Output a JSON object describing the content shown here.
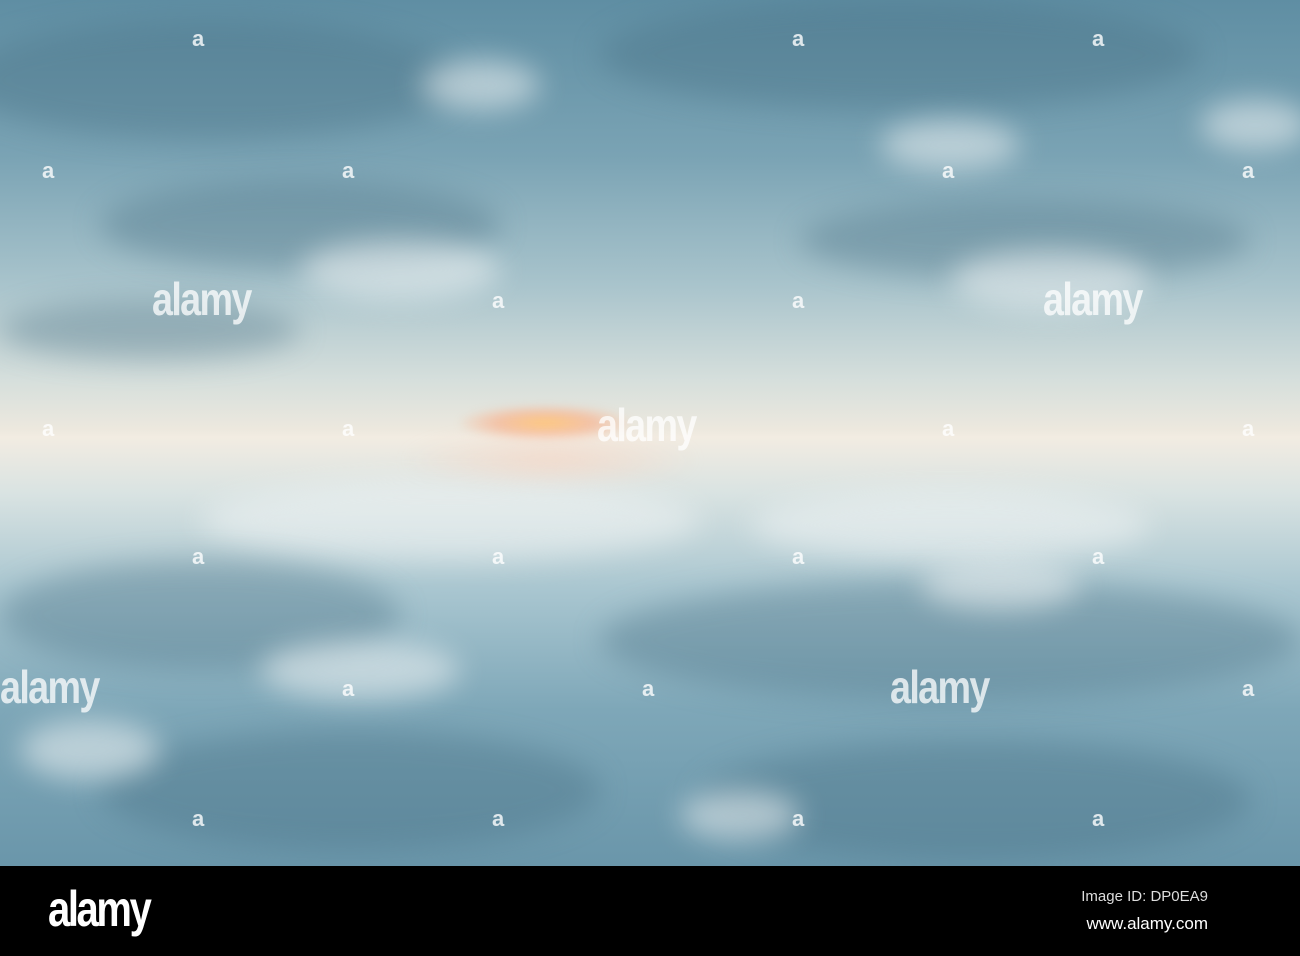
{
  "photo": {
    "subject": "cloudy sky with sunrise reflected in calm water",
    "watermark_text": "alamy",
    "watermark_small": "a"
  },
  "footer": {
    "logo": "alamy",
    "image_id": "Image ID: DP0EA9",
    "url": "www.alamy.com"
  }
}
